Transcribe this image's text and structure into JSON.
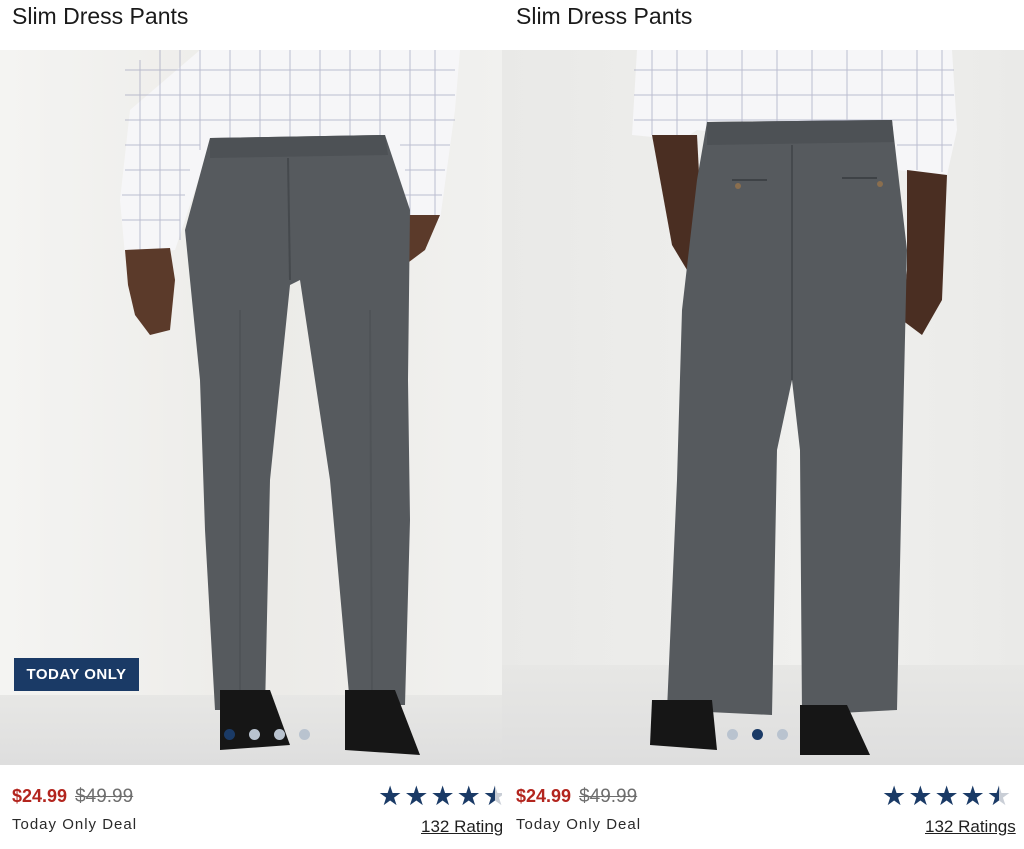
{
  "products": [
    {
      "title": "Slim Dress Pants",
      "badge": "TODAY ONLY",
      "sale_price": "$24.99",
      "original_price": "$49.99",
      "deal_label": "Today Only Deal",
      "rating": 4.5,
      "ratings_label": "132 Ratings",
      "image_dots": {
        "count": 4,
        "active": 0
      },
      "image": "front view of model wearing gray slim dress pants, white checked shirt and black loafers"
    },
    {
      "title": "Slim Dress Pants",
      "sale_price": "$24.99",
      "original_price": "$49.99",
      "deal_label": "Today Only Deal",
      "rating": 4.5,
      "ratings_label": "132 Ratings",
      "image_dots": {
        "count": 3,
        "active": 1
      },
      "image": "back view of model wearing gray slim dress pants, white checked shirt and black loafers"
    }
  ],
  "colors": {
    "sale_price": "#b3251e",
    "brand_navy": "#1a3a66",
    "pants_gray": "#565a5e"
  }
}
